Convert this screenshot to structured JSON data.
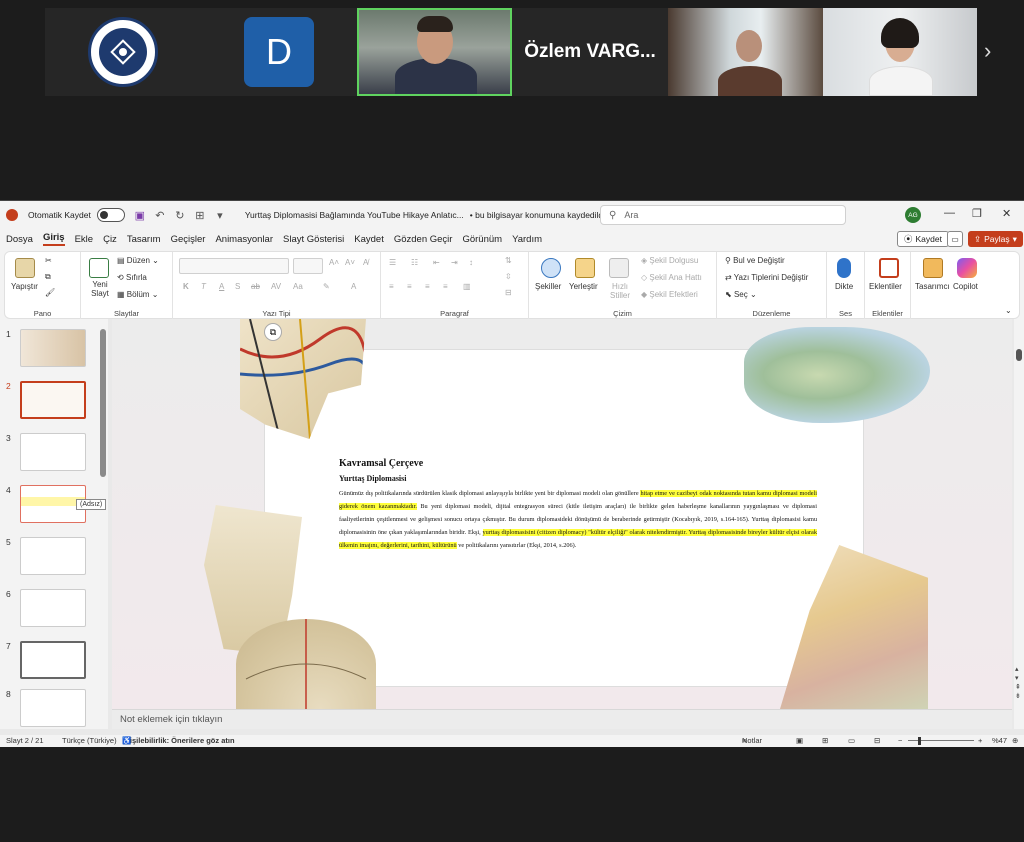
{
  "meeting": {
    "tiles": [
      {
        "type": "logo",
        "alt": "İstanbul Aydın Üniversitesi logo"
      },
      {
        "type": "letter",
        "letter": "D"
      },
      {
        "type": "video"
      },
      {
        "type": "name",
        "name": "Özlem VARG..."
      },
      {
        "type": "video"
      },
      {
        "type": "video"
      }
    ],
    "logo_text": "İSTANBUL AYDIN ÜNİVERSİTESİ",
    "next_icon": "chevron-right-icon"
  },
  "titlebar": {
    "autosave_label": "Otomatik Kaydet",
    "document_title": "Yurttaş Diplomasisi Bağlamında YouTube Hikaye Anlatıc...",
    "save_status": "• bu bilgisayar konumuna kaydedildi",
    "search_placeholder": "Ara",
    "user_initials": "AG"
  },
  "menu": {
    "items": [
      "Dosya",
      "Giriş",
      "Ekle",
      "Çiz",
      "Tasarım",
      "Geçişler",
      "Animasyonlar",
      "Slayt Gösterisi",
      "Kaydet",
      "Gözden Geçir",
      "Görünüm",
      "Yardım"
    ],
    "active": "Giriş",
    "record_button": "Kaydet",
    "share_button": "Paylaş"
  },
  "ribbon": {
    "pano": {
      "label": "Pano",
      "paste": "Yapıştır"
    },
    "slaytlar": {
      "label": "Slaytlar",
      "new_slide": "Yeni Slayt",
      "layout": "Düzen",
      "reset": "Sıfırla",
      "section": "Bölüm"
    },
    "yazi_tipi": {
      "label": "Yazı Tipi"
    },
    "paragraf": {
      "label": "Paragraf"
    },
    "cizim": {
      "label": "Çizim",
      "shapes": "Şekiller",
      "arrange": "Yerleştir",
      "quick_styles": "Hızlı Stiller",
      "fill": "Şekil Dolgusu",
      "outline": "Şekil Ana Hattı",
      "effects": "Şekil Efektleri"
    },
    "duzenleme": {
      "label": "Düzenleme",
      "find": "Bul ve Değiştir",
      "replace_fonts": "Yazı Tiplerini Değiştir",
      "select": "Seç"
    },
    "ses": {
      "label": "Ses",
      "dictate": "Dikte"
    },
    "eklentiler": {
      "label": "Eklentiler",
      "addins": "Eklentiler"
    },
    "designer": "Tasarımcı",
    "copilot": "Copilot"
  },
  "thumbnails": {
    "numbers": [
      "1",
      "2",
      "3",
      "4",
      "5",
      "6",
      "7",
      "8"
    ],
    "selected": "2",
    "tooltip": "(Adsız)"
  },
  "slide": {
    "title": "Kavramsal Çerçeve",
    "subtitle": "Yurttaş Diplomasisi",
    "body_segments": [
      {
        "text": "Günümüz dış politikalarında sürdürülen klasik diplomasi anlayışıyla birlikte yeni bir diplomasi modeli olan gönüllere ",
        "hl": false
      },
      {
        "text": "hitap etme ve cazibeyi odak noktasında tutan kamu diplomasi modeli giderek önem kazanmaktadır.",
        "hl": true
      },
      {
        "text": " Bu yeni diplomasi modeli, dijital entegrasyon süreci (kitle iletişim araçları) ile birlikte gelen haberleşme kanallarının yaygınlaşması ve diplomasi faaliyetlerinin çeşitlenmesi ve gelişmesi sonucu ortaya çıkmıştır. Bu durum diplomasideki dönüşümü de beraberinde getirmiştir (Kocabıyık, 2019, s.164-165). Yurttaş diplomasisi kamu diplomasisinin öne çıkan yaklaşımlarından biridir. Ekşi, ",
        "hl": false
      },
      {
        "text": "yurttaş diplomasisini (citizen diplomacy) \"kültür elçiliği\" olarak nitelendirmiştir. Yurttaş diplomasisinde bireyler kültür elçisi olarak ülkenin imajını, değerlerini, tarihini, kültürünü",
        "hl": true
      },
      {
        "text": " ve politikalarını yansıtırlar (Ekşi, 2014, s.206).",
        "hl": false
      }
    ]
  },
  "notes_placeholder": "Not eklemek için tıklayın",
  "status": {
    "slide_indicator": "Slayt 2 / 21",
    "language": "Türkçe (Türkiye)",
    "accessibility": "Erişilebilirlik: Önerilere göz atın",
    "notes": "Notlar",
    "zoom": "%47"
  }
}
